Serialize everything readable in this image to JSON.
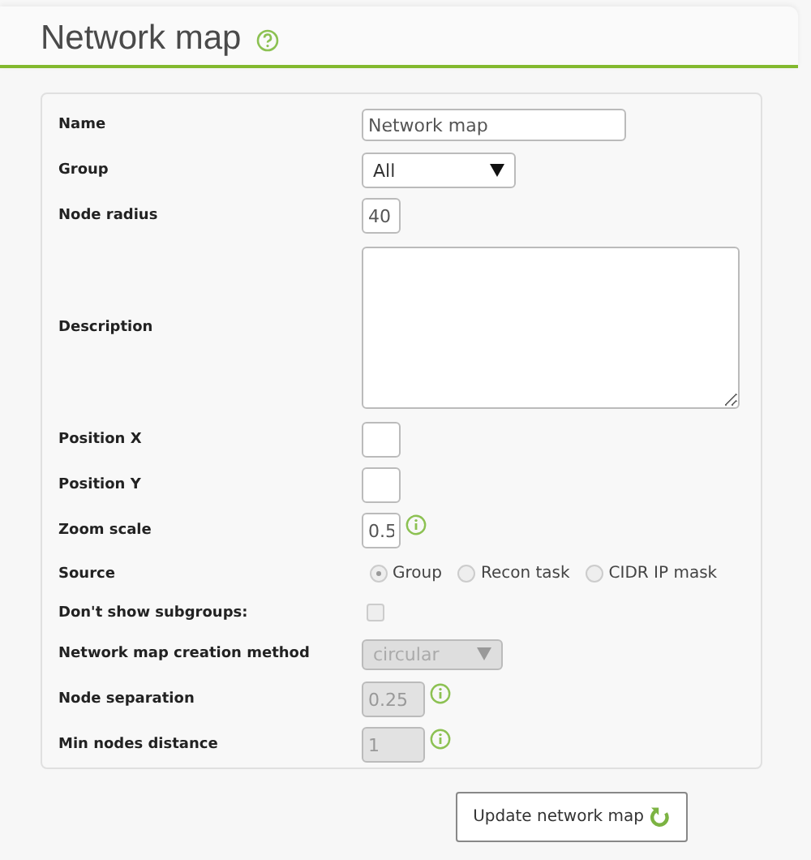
{
  "page": {
    "title": "Network map"
  },
  "form": {
    "rows": [
      {
        "label": "Name",
        "kind": "text",
        "value": "Network map",
        "disabled": false,
        "info_icon": false
      },
      {
        "label": "Group",
        "kind": "select",
        "value": "All",
        "disabled": false,
        "info_icon": false
      },
      {
        "label": "Node radius",
        "kind": "text",
        "value": "40",
        "disabled": false,
        "info_icon": false
      },
      {
        "label": "Description",
        "kind": "textarea",
        "disabled": false,
        "info_icon": false
      },
      {
        "label": "Position X",
        "kind": "text",
        "disabled": false,
        "info_icon": false
      },
      {
        "label": "Position Y",
        "kind": "text",
        "disabled": false,
        "info_icon": false
      },
      {
        "label": "Zoom scale",
        "kind": "text",
        "value": "0.5",
        "disabled": false,
        "info_icon": true
      },
      {
        "label": "Source",
        "kind": "radio",
        "options": [
          {
            "label": "Group",
            "selected": true
          },
          {
            "label": "Recon task",
            "selected": false
          },
          {
            "label": "CIDR IP mask",
            "selected": false
          }
        ]
      },
      {
        "label": "Don't show subgroups:",
        "kind": "checkbox",
        "checked": false
      },
      {
        "label": "Network map creation method",
        "kind": "select",
        "value": "circular",
        "disabled": true,
        "info_icon": false
      },
      {
        "label": "Node separation",
        "kind": "text",
        "value": "0.25",
        "disabled": true,
        "info_icon": true
      },
      {
        "label": "Min nodes distance",
        "kind": "text",
        "value": "1",
        "disabled": true,
        "info_icon": true
      }
    ]
  },
  "buttons": [
    {
      "label": "Update network map"
    }
  ]
}
